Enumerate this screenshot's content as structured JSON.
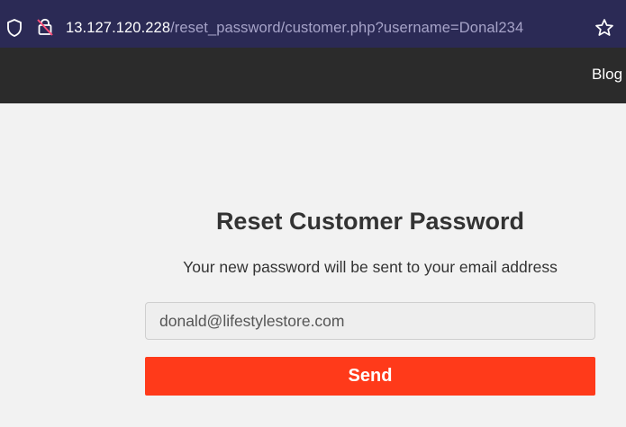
{
  "browser": {
    "url_host": "13.127.120.228",
    "url_path": "/reset_password/customer.php?username=Donal234",
    "shield_icon": "shield-icon",
    "lock_icon": "insecure-lock-icon",
    "bookmark_icon": "star-icon"
  },
  "navbar": {
    "link_label": "Blog"
  },
  "form": {
    "title": "Reset Customer Password",
    "subtitle": "Your new password will be sent to your email address",
    "email_value": "donald@lifestylestore.com",
    "send_label": "Send"
  },
  "colors": {
    "browser_bar": "#2b2a55",
    "navbar": "#2b2b2b",
    "send_button": "#ff3a1a",
    "page_background": "#f2f2f2"
  }
}
